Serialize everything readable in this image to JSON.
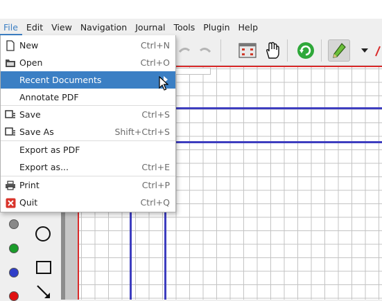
{
  "menubar": {
    "items": [
      {
        "label": "File",
        "active": true
      },
      {
        "label": "Edit"
      },
      {
        "label": "View"
      },
      {
        "label": "Navigation"
      },
      {
        "label": "Journal"
      },
      {
        "label": "Tools"
      },
      {
        "label": "Plugin"
      },
      {
        "label": "Help"
      }
    ]
  },
  "file_menu": {
    "items": [
      {
        "label": "New",
        "shortcut": "Ctrl+N",
        "icon": "new-document-icon"
      },
      {
        "label": "Open",
        "shortcut": "Ctrl+O",
        "icon": "open-folder-icon"
      },
      {
        "label": "Recent Documents",
        "shortcut": "",
        "icon": "",
        "highlighted": true,
        "submenu": true
      },
      {
        "label": "Annotate PDF",
        "shortcut": "",
        "icon": ""
      },
      {
        "label": "Save",
        "shortcut": "Ctrl+S",
        "icon": "save-icon"
      },
      {
        "label": "Save As",
        "shortcut": "Shift+Ctrl+S",
        "icon": "save-as-icon"
      },
      {
        "label": "Export as PDF",
        "shortcut": "",
        "icon": ""
      },
      {
        "label": "Export as...",
        "shortcut": "Ctrl+E",
        "icon": ""
      },
      {
        "label": "Print",
        "shortcut": "Ctrl+P",
        "icon": "printer-icon"
      },
      {
        "label": "Quit",
        "shortcut": "Ctrl+Q",
        "icon": "quit-icon"
      }
    ]
  },
  "colors": {
    "accent": "#3b7fc4",
    "palette_gray": "#888888",
    "palette_green": "#1a9c2a",
    "palette_blue": "#2f3ec8",
    "palette_red": "#e01010",
    "ink_blue": "#3d3dbf",
    "margin_red": "#d92a2a"
  }
}
